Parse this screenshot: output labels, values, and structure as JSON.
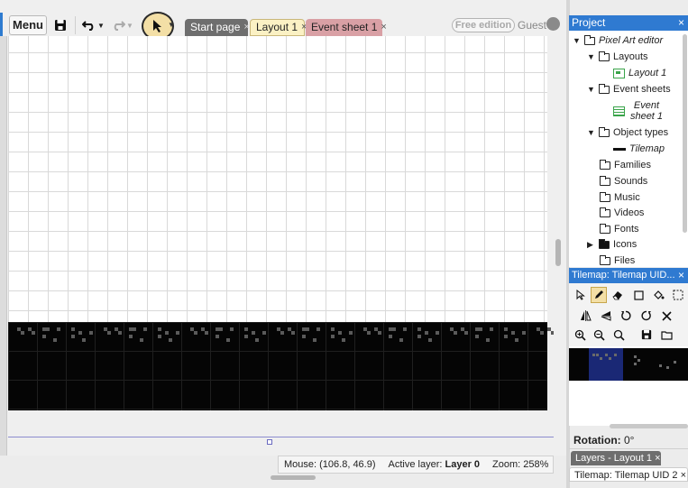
{
  "toolbar": {
    "menu_label": "Menu",
    "save_icon": "save-icon",
    "undo_icon": "undo-icon",
    "redo_icon": "redo-icon",
    "select_icon": "pointer-icon"
  },
  "tabs": [
    {
      "label": "Start page",
      "close": "×"
    },
    {
      "label": "Layout 1",
      "close": "×"
    },
    {
      "label": "Event sheet 1",
      "close": "×"
    }
  ],
  "account": {
    "badge": "Free edition",
    "user": "Guest"
  },
  "statusbar": {
    "mouse_label": "Mouse:",
    "mouse_value": "(106.8, 46.9)",
    "layer_label": "Active layer:",
    "layer_value": "Layer 0",
    "zoom_label": "Zoom:",
    "zoom_value": "258%"
  },
  "project": {
    "title": "Project",
    "close": "×",
    "items": [
      {
        "label": "Pixel Art editor"
      },
      {
        "label": "Layouts"
      },
      {
        "label": "Layout 1"
      },
      {
        "label": "Event sheets"
      },
      {
        "label": "Event sheet 1"
      },
      {
        "label": "Object types"
      },
      {
        "label": "Tilemap"
      },
      {
        "label": "Families"
      },
      {
        "label": "Sounds"
      },
      {
        "label": "Music"
      },
      {
        "label": "Videos"
      },
      {
        "label": "Fonts"
      },
      {
        "label": "Icons"
      },
      {
        "label": "Files"
      }
    ]
  },
  "tilemap_panel": {
    "title": "Tilemap: Tilemap UID...",
    "close": "×",
    "tools": [
      "pointer-icon",
      "pencil-icon",
      "eraser-icon",
      "rectangle-icon",
      "fill-icon",
      "selection-icon",
      "mirror-icon",
      "flip-icon",
      "rotate-ccw-icon",
      "rotate-cw-icon",
      "clear-icon",
      "zoom-in-icon",
      "zoom-out-icon",
      "zoom-reset-icon",
      "save-icon",
      "folder-icon"
    ]
  },
  "properties": {
    "rotation_label": "Rotation:",
    "rotation_value": "0°"
  },
  "bottom_tabs": [
    {
      "label": "Layers - Layout 1",
      "close": "×"
    },
    {
      "label": "Tilemap: Tilemap UID 2",
      "close": "×"
    }
  ],
  "colors": {
    "accent": "#2f7ad1",
    "active_tool": "#f3dfa6",
    "tab_layout": "#fbf1c4",
    "tab_event": "#d9a0a5"
  }
}
